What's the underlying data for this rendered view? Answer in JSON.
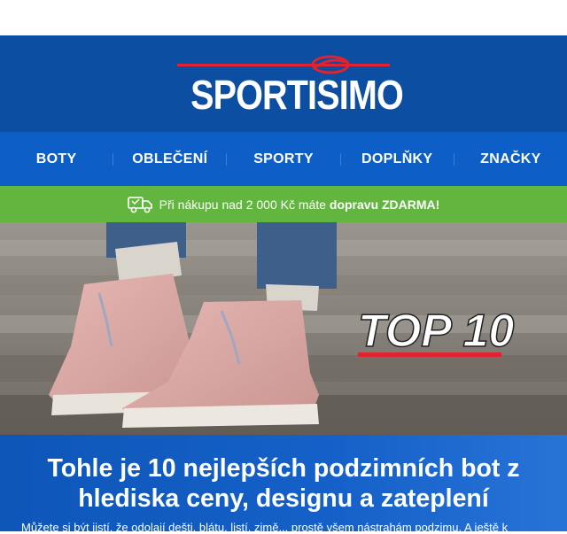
{
  "brand": {
    "logo_text": "SPORTISIMO"
  },
  "nav": {
    "items": [
      "BOTY",
      "OBLEČENÍ",
      "SPORTY",
      "DOPLŇKY",
      "ZNAČKY"
    ]
  },
  "promo": {
    "text_prefix": "Při nákupu nad 2 000 Kč máte ",
    "text_bold": "dopravu ZDARMA!",
    "icon": "delivery-truck-icon"
  },
  "hero": {
    "badge_text": "TOP 10",
    "image": "pink-winter-boots-on-stone-steps"
  },
  "article": {
    "title": "Tohle je 10 nejlepších podzimních bot z hlediska ceny, designu a zateplení",
    "intro": "Můžete si být jistí, že odolají dešti, blátu, listí, zimě... prostě všem nástrahám podzimu. A ještě k"
  },
  "colors": {
    "header_bg": "#0b4ea2",
    "nav_bg": "#0d5ec7",
    "promo_bg": "#62b640",
    "logo_red": "#e0232e"
  }
}
